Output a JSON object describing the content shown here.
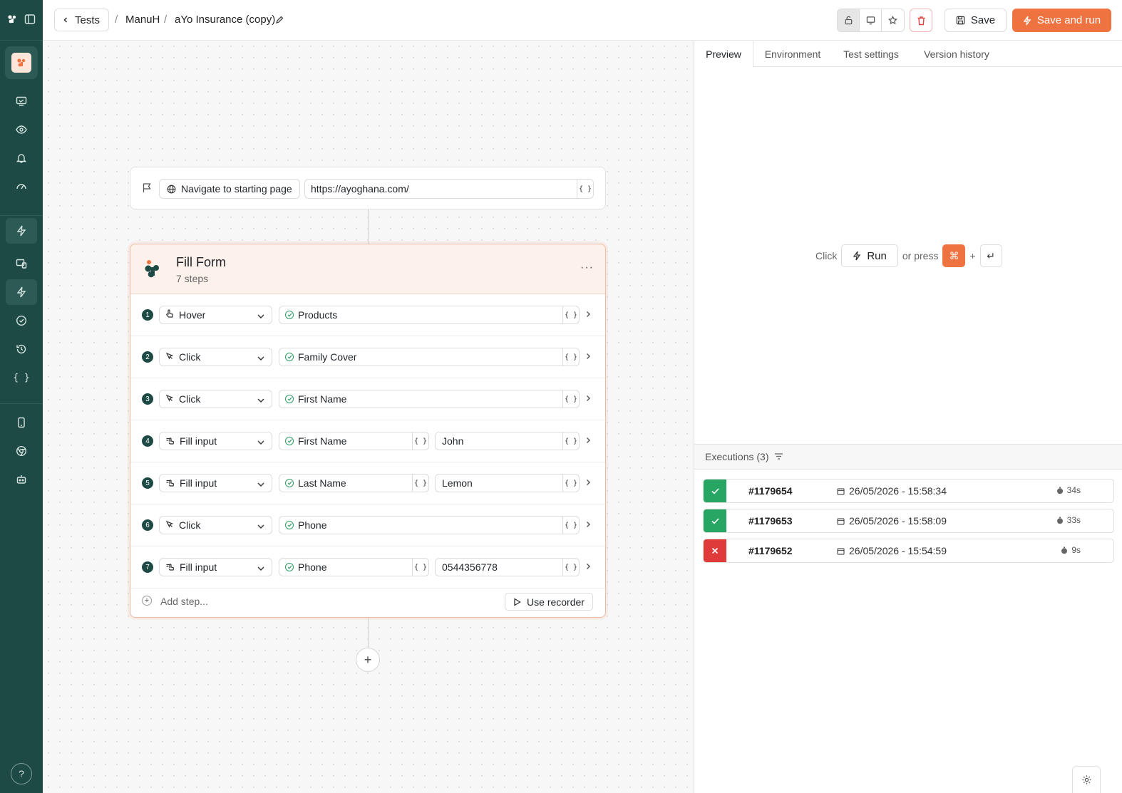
{
  "header": {
    "back_label": "Tests",
    "breadcrumb": [
      "ManuH",
      "aYo Insurance (copy)"
    ],
    "save_label": "Save",
    "save_and_run_label": "Save and run"
  },
  "canvas": {
    "navigate": {
      "label": "Navigate to starting page",
      "url": "https://ayoghana.com/"
    },
    "form": {
      "title": "Fill Form",
      "subtitle": "7 steps",
      "steps": [
        {
          "num": "1",
          "action": "Hover",
          "icon": "hand-pointer-icon",
          "target": "Products",
          "value": null
        },
        {
          "num": "2",
          "action": "Click",
          "icon": "cursor-icon",
          "target": "Family Cover",
          "value": null
        },
        {
          "num": "3",
          "action": "Click",
          "icon": "cursor-icon",
          "target": "First Name",
          "value": null
        },
        {
          "num": "4",
          "action": "Fill input",
          "icon": "keyboard-tap-icon",
          "target": "First Name",
          "value": "John"
        },
        {
          "num": "5",
          "action": "Fill input",
          "icon": "keyboard-tap-icon",
          "target": "Last Name",
          "value": "Lemon"
        },
        {
          "num": "6",
          "action": "Click",
          "icon": "cursor-icon",
          "target": "Phone",
          "value": null
        },
        {
          "num": "7",
          "action": "Fill input",
          "icon": "keyboard-tap-icon",
          "target": "Phone",
          "value": "0544356778"
        }
      ],
      "add_step_label": "Add step...",
      "use_recorder_label": "Use recorder"
    },
    "var_label": "{ }"
  },
  "panel": {
    "tabs": [
      "Preview",
      "Environment",
      "Test settings",
      "Version history"
    ],
    "active_tab": "Preview",
    "run_hint": {
      "click": "Click",
      "run": "Run",
      "or_press": "or press",
      "cmd": "⌘",
      "plus": "+",
      "ret": "↵"
    },
    "executions_title": "Executions (3)",
    "executions": [
      {
        "status": "passed",
        "id": "#1179654",
        "date": "26/05/2026 - 15:58:34",
        "duration": "34s"
      },
      {
        "status": "passed",
        "id": "#1179653",
        "date": "26/05/2026 - 15:58:09",
        "duration": "33s"
      },
      {
        "status": "failed",
        "id": "#1179652",
        "date": "26/05/2026 - 15:54:59",
        "duration": "9s"
      }
    ]
  },
  "colors": {
    "sidebar": "#1d4a44",
    "accent": "#ef7340",
    "success": "#27a563",
    "danger": "#e03b3b"
  }
}
